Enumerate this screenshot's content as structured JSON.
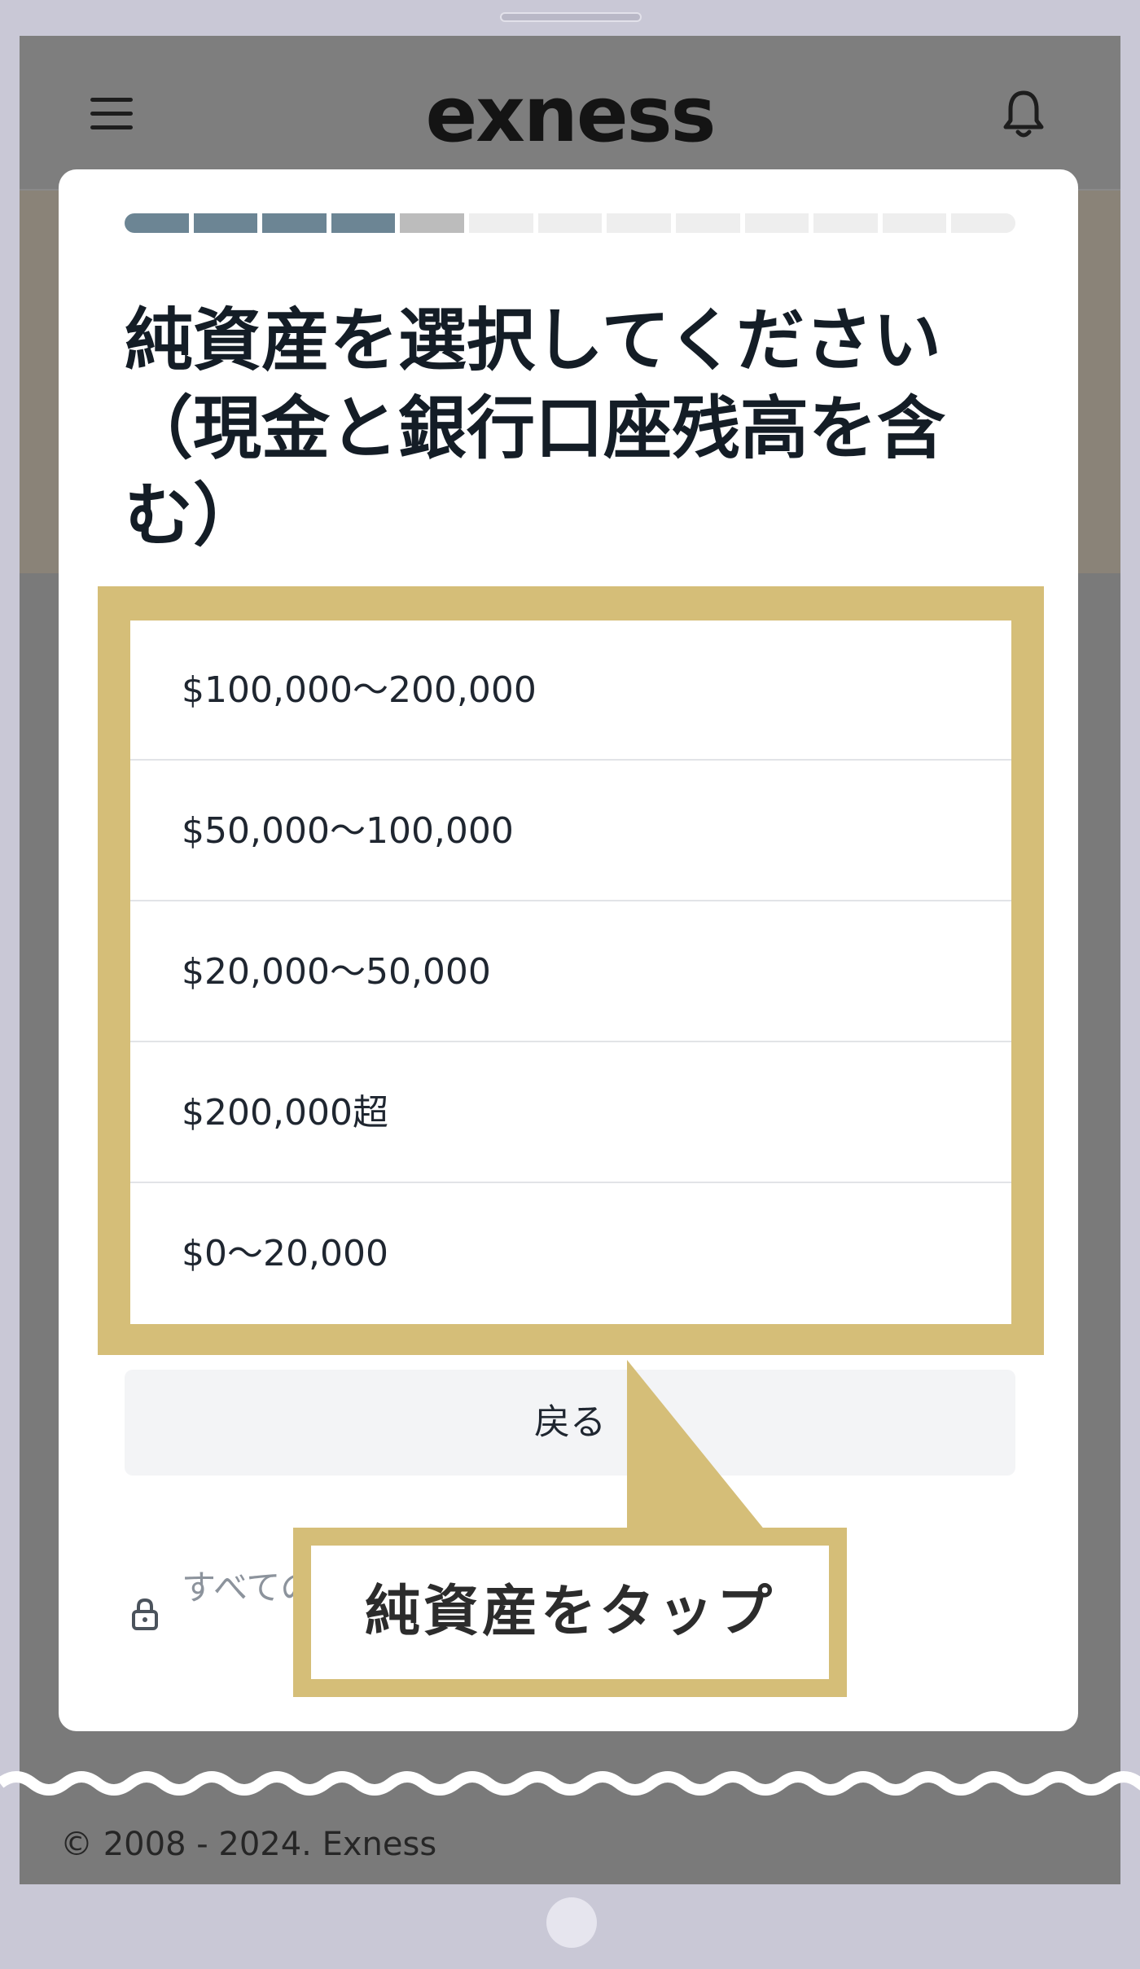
{
  "app": {
    "brand": "exness"
  },
  "progress": {
    "total_steps": 13,
    "completed_steps": 4,
    "current_step": 5,
    "colors": {
      "completed": "#6c8594",
      "current": "#bcbcbc",
      "pending": "#eeeeee"
    }
  },
  "dialog": {
    "title": "純資産を選択してください（現金と銀行口座残高を含む）",
    "options": [
      {
        "label": "$100,000～200,000"
      },
      {
        "label": "$50,000～100,000"
      },
      {
        "label": "$20,000～50,000"
      },
      {
        "label": "$200,000超"
      },
      {
        "label": "$0～20,000"
      }
    ],
    "back_label": "戻る",
    "secure_text": "すべてのデータは暗号化されています"
  },
  "annotation": {
    "callout_text": "純資産をタップ",
    "color": "#d5be78"
  },
  "footer": {
    "copyright": "© 2008 - 2024. Exness"
  }
}
